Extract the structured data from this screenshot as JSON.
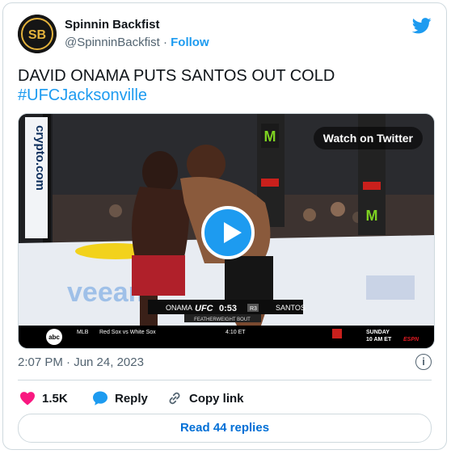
{
  "author": {
    "name": "Spinnin Backfist",
    "handle": "@SpinninBackfist",
    "separator": "·",
    "follow_label": "Follow",
    "avatar_text": "SB"
  },
  "tweet": {
    "text": "DAVID ONAMA PUTS SANTOS OUT COLD",
    "hashtag": "#UFCJacksonville"
  },
  "media": {
    "watch_label": "Watch on Twitter",
    "overlay": {
      "sponsor_left": "crypto.com",
      "fighter_left": "ONAMA",
      "brand": "UFC",
      "clock": "0:53",
      "round": "R3",
      "fighter_right": "SANTOS",
      "bout": "FEATHERWEIGHT BOUT",
      "mat_banner": "veeam",
      "network": "abc",
      "ticker_league": "MLB",
      "ticker_game": "Red Sox vs White Sox",
      "ticker_time": "4:10 ET",
      "ticker_day": "SUNDAY",
      "ticker_slot": "10 AM ET",
      "ticker_net": "ESPN"
    }
  },
  "meta": {
    "timestamp": "2:07 PM · Jun 24, 2023",
    "info_icon": "i"
  },
  "actions": {
    "likes": "1.5K",
    "reply_label": "Reply",
    "copy_label": "Copy link"
  },
  "read_replies_label": "Read 44 replies",
  "colors": {
    "accent": "#1d9bf0",
    "like": "#f91880",
    "text": "#0f1419",
    "muted": "#536471"
  }
}
